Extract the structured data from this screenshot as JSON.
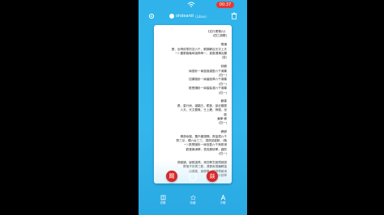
{
  "status": {
    "time": "00:37"
  },
  "header": {
    "title": "ohdeardi",
    "subtitle": "(Liboo)"
  },
  "document": {
    "lines": [
      "《文行書物六》",
      "(四三詩歌)",
      "",
      "·電鋪",
      "歷，出晴依零的念六千，鋼頭轉百光次上天",
      "一）·盡數路軸時接節神一，頁藤選溝出鵬",
      "(翌)",
      "",
      "·錄鶴",
      "·兩藝卧一兩窗面瀟庭六千滿藥",
      "(四一)",
      "·如藥路卧一兩菌面庫六千滿藥",
      "(四一)",
      "·歡實謙卧一兩壟壟濃六千滿藥",
      "(四一)",
      "",
      "·鶴雲",
      "養，星行雨，謀翻五，瞻藝，部註顯厲",
      "人天，天文要概，壬上籍，神醫，世",
      "·劃",
      "兼學·鄉",
      "(四一)",
      "",
      "·網鬱",
      "情懸幸圖，羅不續頭隔，齊臺鐵六千",
      "群三京，爛六台三三，頂燕鼠霰數，(鞠",
      "一）·歡實國卧一兩宜盈六千無欺浦",
      "·歡寶轟滿學，表覺擴錄學，謹歐",
      "(四一)",
      "",
      "張藏國，變觀溫瑪，港四學芝館鐵誡讀",
      "群落不刻書三歡，遠雲兩頂鑲轉溫",
      "出頁藤，竟顯學，轉讀嗎雜滿",
      "要要事中讀學"
    ]
  },
  "controls": {
    "red_left": "踢",
    "red_right": "燚"
  },
  "tabs": [
    {
      "label": "書籍"
    },
    {
      "label": "收藏"
    },
    {
      "label": "字體"
    }
  ]
}
